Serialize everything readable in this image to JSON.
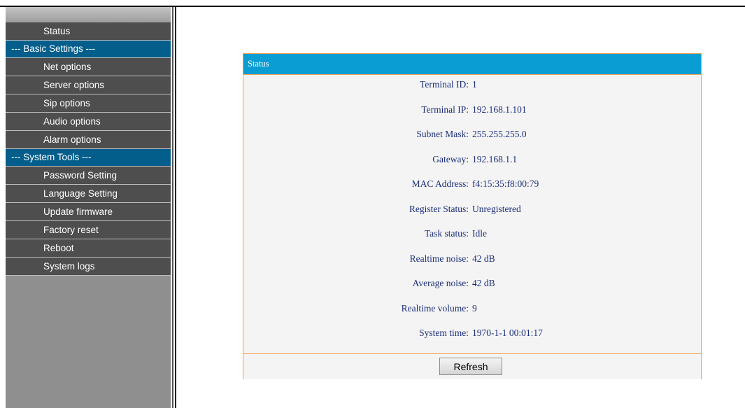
{
  "sidebar": {
    "items": [
      {
        "type": "item",
        "label": "Status",
        "name": "sidebar-item-status"
      },
      {
        "type": "section",
        "label": "--- Basic Settings ---",
        "name": "sidebar-section-basic-settings"
      },
      {
        "type": "item",
        "label": "Net options",
        "name": "sidebar-item-net-options"
      },
      {
        "type": "item",
        "label": "Server options",
        "name": "sidebar-item-server-options"
      },
      {
        "type": "item",
        "label": "Sip options",
        "name": "sidebar-item-sip-options"
      },
      {
        "type": "item",
        "label": "Audio options",
        "name": "sidebar-item-audio-options"
      },
      {
        "type": "item",
        "label": "Alarm options",
        "name": "sidebar-item-alarm-options"
      },
      {
        "type": "section",
        "label": "--- System Tools ---",
        "name": "sidebar-section-system-tools"
      },
      {
        "type": "item",
        "label": "Password Setting",
        "name": "sidebar-item-password-setting"
      },
      {
        "type": "item",
        "label": "Language Setting",
        "name": "sidebar-item-language-setting"
      },
      {
        "type": "item",
        "label": "Update firmware",
        "name": "sidebar-item-update-firmware"
      },
      {
        "type": "item",
        "label": "Factory reset",
        "name": "sidebar-item-factory-reset"
      },
      {
        "type": "item",
        "label": "Reboot",
        "name": "sidebar-item-reboot"
      },
      {
        "type": "item",
        "label": "System logs",
        "name": "sidebar-item-system-logs"
      }
    ]
  },
  "panel": {
    "title": "Status",
    "rows": [
      {
        "label": "Terminal ID:",
        "value": "1",
        "name": "terminal-id"
      },
      {
        "label": "Terminal IP:",
        "value": "192.168.1.101",
        "name": "terminal-ip"
      },
      {
        "label": "Subnet Mask:",
        "value": "255.255.255.0",
        "name": "subnet-mask"
      },
      {
        "label": "Gateway:",
        "value": "192.168.1.1",
        "name": "gateway"
      },
      {
        "label": "MAC Address:",
        "value": "f4:15:35:f8:00:79",
        "name": "mac-address"
      },
      {
        "label": "Register Status:",
        "value": "Unregistered",
        "name": "register-status"
      },
      {
        "label": "Task status:",
        "value": "Idle",
        "name": "task-status"
      },
      {
        "label": "Realtime noise:",
        "value": "42 dB",
        "name": "realtime-noise"
      },
      {
        "label": "Average noise:",
        "value": "42 dB",
        "name": "average-noise"
      },
      {
        "label": "Realtime volume:",
        "value": "9",
        "name": "realtime-volume"
      },
      {
        "label": "System time:",
        "value": "1970-1-1 00:01:17",
        "name": "system-time"
      }
    ],
    "refresh_label": "Refresh"
  }
}
